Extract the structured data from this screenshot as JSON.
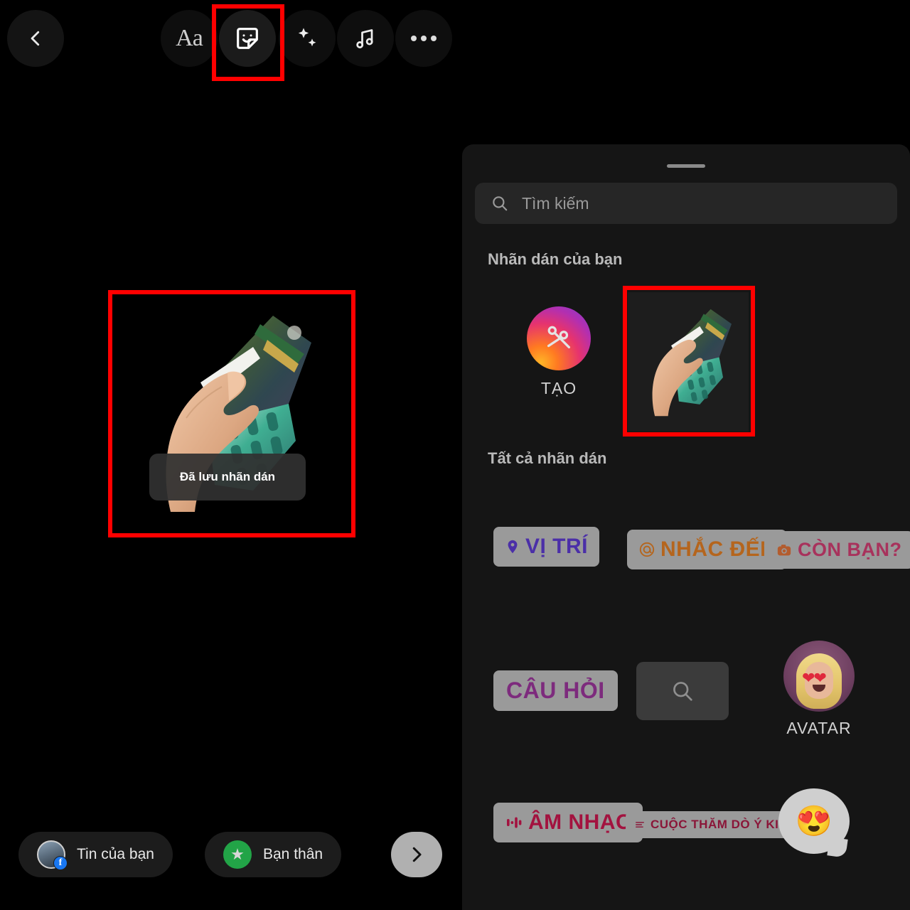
{
  "toolbar": {
    "back_icon": "chevron-left-icon",
    "text_tool_label": "Aa",
    "sticker_icon": "sticker-smiley-icon",
    "effects_icon": "sparkles-icon",
    "music_icon": "music-note-icon",
    "more_icon": "ellipsis-icon"
  },
  "canvas": {
    "sticker_description": "hand-holding-banknotes-sticker",
    "toast_text": "Đã lưu nhãn dán"
  },
  "tray": {
    "search": {
      "placeholder": "Tìm kiếm",
      "icon": "search-icon"
    },
    "your_stickers": {
      "title": "Nhãn dán của bạn",
      "create": {
        "label": "TẠO",
        "icon": "scissors-icon"
      },
      "saved": [
        {
          "name": "hand-holding-banknotes-sticker"
        }
      ]
    },
    "all_stickers": {
      "title": "Tất cả nhãn dán",
      "rows": [
        [
          {
            "label": "VỊ TRÍ",
            "icon": "location-pin-icon",
            "style": "loc",
            "type": "pill"
          },
          {
            "label": "NHẮC ĐẾN",
            "icon": "at-threads-icon",
            "style": "mention",
            "type": "pill"
          },
          {
            "label": "CÒN BẠN?",
            "icon": "camera-icon",
            "style": "addyours",
            "type": "pill"
          }
        ],
        [
          {
            "label": "CÂU HỎI",
            "icon": "",
            "style": "question",
            "type": "pill"
          },
          {
            "label": "",
            "icon": "search-icon",
            "style": "",
            "type": "gif"
          },
          {
            "label": "AVATAR",
            "icon": "avatar-heart-eyes-icon",
            "style": "",
            "type": "avatar"
          }
        ],
        [
          {
            "label": "ÂM NHẠC",
            "icon": "audio-waveform-icon",
            "style": "music",
            "type": "pill"
          },
          {
            "label": "CUỘC THĂM DÒ Ý KIẾN",
            "icon": "poll-bars-icon",
            "style": "poll",
            "type": "pill"
          },
          {
            "label": "😍",
            "icon": "emoji-reaction-bubble-icon",
            "style": "",
            "type": "bubble"
          }
        ]
      ]
    }
  },
  "bottom_bar": {
    "your_story_label": "Tin của bạn",
    "your_story_badge": "f",
    "close_friends_label": "Bạn thân",
    "close_friends_icon": "star-icon",
    "next_icon": "chevron-right-icon"
  },
  "annotations": {
    "color": "#ff0000",
    "boxes": [
      "sticker-tool-button",
      "canvas-sticker-area",
      "saved-sticker-thumbnail"
    ]
  }
}
